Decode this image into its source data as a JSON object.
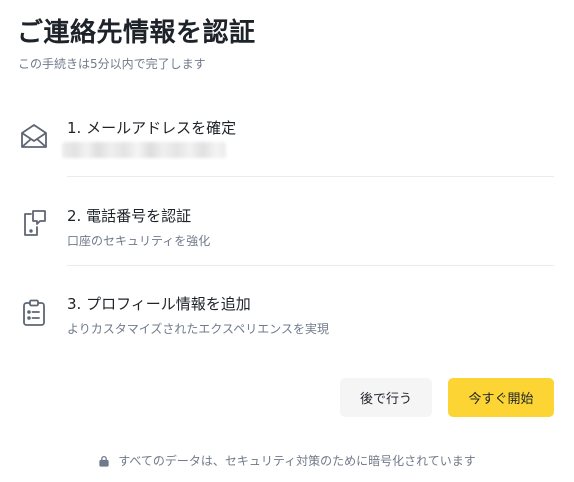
{
  "header": {
    "title": "ご連絡先情報を認証",
    "subtitle": "この手続きは5分以内で完了します"
  },
  "steps": [
    {
      "icon": "envelope-icon",
      "title": "1. メールアドレスを確定",
      "subtitle": ""
    },
    {
      "icon": "phone-chat-icon",
      "title": "2. 電話番号を認証",
      "subtitle": "口座のセキュリティを強化"
    },
    {
      "icon": "clipboard-icon",
      "title": "3. プロフィール情報を追加",
      "subtitle": "よりカスタマイズされたエクスペリエンスを実現"
    }
  ],
  "actions": {
    "later_label": "後で行う",
    "start_label": "今すぐ開始"
  },
  "footer": {
    "icon": "lock-icon",
    "text": "すべてのデータは、セキュリティ対策のために暗号化されています"
  },
  "colors": {
    "primary": "#fcd535",
    "text": "#1e2329",
    "muted": "#707a8a",
    "icon": "#5e6673",
    "divider": "#eaecef",
    "secondary_button": "#f5f5f5"
  }
}
